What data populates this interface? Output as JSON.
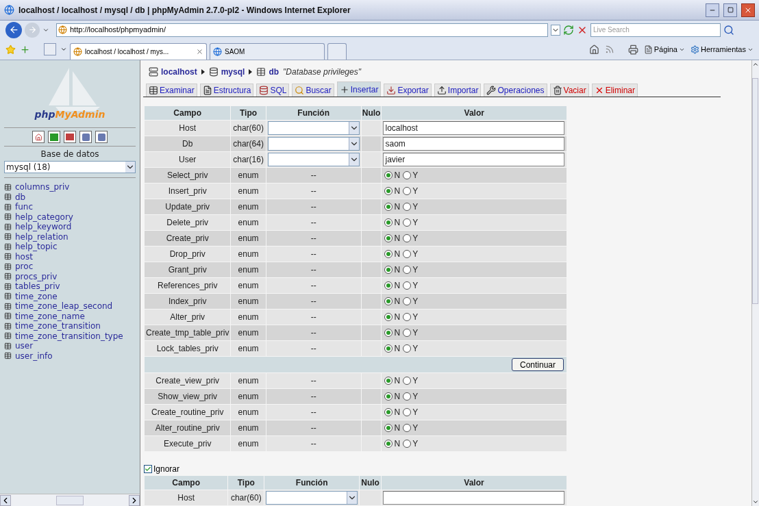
{
  "window": {
    "title": "localhost / localhost / mysql / db | phpMyAdmin 2.7.0-pl2 - Windows Internet Explorer",
    "address": "http://localhost/phpmyadmin/",
    "search_placeholder": "Live Search",
    "tabs": [
      {
        "label": "localhost / localhost / mys...",
        "selected": true
      },
      {
        "label": "SAOM",
        "selected": false
      }
    ],
    "tools": [
      "Página",
      "Herramientas"
    ]
  },
  "sidebar": {
    "logo": [
      "php",
      "MyAdmin"
    ],
    "database_label": "Base de datos",
    "database": "mysql (18)",
    "tables": [
      "columns_priv",
      "db",
      "func",
      "help_category",
      "help_keyword",
      "help_relation",
      "help_topic",
      "host",
      "proc",
      "procs_priv",
      "tables_priv",
      "time_zone",
      "time_zone_leap_second",
      "time_zone_name",
      "time_zone_transition",
      "time_zone_transition_type",
      "user",
      "user_info"
    ]
  },
  "breadcrumb": [
    {
      "label": "localhost",
      "kind": "server"
    },
    {
      "label": "mysql",
      "kind": "database"
    },
    {
      "label": "db",
      "kind": "table"
    }
  ],
  "table_comment": "\"Database privileges\"",
  "tabs": [
    {
      "label": "Examinar",
      "kind": "browse",
      "selected": false,
      "danger": false
    },
    {
      "label": "Estructura",
      "kind": "structure",
      "selected": false,
      "danger": false
    },
    {
      "label": "SQL",
      "kind": "sql",
      "selected": false,
      "danger": false
    },
    {
      "label": "Buscar",
      "kind": "search",
      "selected": false,
      "danger": false
    },
    {
      "label": "Insertar",
      "kind": "insert",
      "selected": true,
      "danger": false
    },
    {
      "label": "Exportar",
      "kind": "export",
      "selected": false,
      "danger": false
    },
    {
      "label": "Importar",
      "kind": "import",
      "selected": false,
      "danger": false
    },
    {
      "label": "Operaciones",
      "kind": "operations",
      "selected": false,
      "danger": false
    },
    {
      "label": "Vaciar",
      "kind": "empty",
      "selected": false,
      "danger": true
    },
    {
      "label": "Eliminar",
      "kind": "drop",
      "selected": false,
      "danger": true
    }
  ],
  "sections": [
    {
      "columns": [
        "Campo",
        "Tipo",
        "Función",
        "Nulo",
        "Valor"
      ],
      "rows": [
        {
          "kind": "text",
          "field": "Host",
          "type": "char(60)",
          "value": "localhost"
        },
        {
          "kind": "text",
          "field": "Db",
          "type": "char(64)",
          "value": "saom"
        },
        {
          "kind": "text",
          "field": "User",
          "type": "char(16)",
          "value": "javier"
        },
        {
          "kind": "enum",
          "field": "Select_priv",
          "type": "enum",
          "function": "--",
          "options": [
            {
              "label": "N",
              "selected": true
            },
            {
              "label": "Y",
              "selected": false
            }
          ]
        },
        {
          "kind": "enum",
          "field": "Insert_priv",
          "type": "enum",
          "function": "--",
          "options": [
            {
              "label": "N",
              "selected": true
            },
            {
              "label": "Y",
              "selected": false
            }
          ]
        },
        {
          "kind": "enum",
          "field": "Update_priv",
          "type": "enum",
          "function": "--",
          "options": [
            {
              "label": "N",
              "selected": true
            },
            {
              "label": "Y",
              "selected": false
            }
          ]
        },
        {
          "kind": "enum",
          "field": "Delete_priv",
          "type": "enum",
          "function": "--",
          "options": [
            {
              "label": "N",
              "selected": true
            },
            {
              "label": "Y",
              "selected": false
            }
          ]
        },
        {
          "kind": "enum",
          "field": "Create_priv",
          "type": "enum",
          "function": "--",
          "options": [
            {
              "label": "N",
              "selected": true
            },
            {
              "label": "Y",
              "selected": false
            }
          ]
        },
        {
          "kind": "enum",
          "field": "Drop_priv",
          "type": "enum",
          "function": "--",
          "options": [
            {
              "label": "N",
              "selected": true
            },
            {
              "label": "Y",
              "selected": false
            }
          ]
        },
        {
          "kind": "enum",
          "field": "Grant_priv",
          "type": "enum",
          "function": "--",
          "options": [
            {
              "label": "N",
              "selected": true
            },
            {
              "label": "Y",
              "selected": false
            }
          ]
        },
        {
          "kind": "enum",
          "field": "References_priv",
          "type": "enum",
          "function": "--",
          "options": [
            {
              "label": "N",
              "selected": true
            },
            {
              "label": "Y",
              "selected": false
            }
          ]
        },
        {
          "kind": "enum",
          "field": "Index_priv",
          "type": "enum",
          "function": "--",
          "options": [
            {
              "label": "N",
              "selected": true
            },
            {
              "label": "Y",
              "selected": false
            }
          ]
        },
        {
          "kind": "enum",
          "field": "Alter_priv",
          "type": "enum",
          "function": "--",
          "options": [
            {
              "label": "N",
              "selected": true
            },
            {
              "label": "Y",
              "selected": false
            }
          ]
        },
        {
          "kind": "enum",
          "field": "Create_tmp_table_priv",
          "type": "enum",
          "function": "--",
          "options": [
            {
              "label": "N",
              "selected": true
            },
            {
              "label": "Y",
              "selected": false
            }
          ]
        },
        {
          "kind": "enum",
          "field": "Lock_tables_priv",
          "type": "enum",
          "function": "--",
          "options": [
            {
              "label": "N",
              "selected": true
            },
            {
              "label": "Y",
              "selected": false
            }
          ]
        },
        {
          "kind": "submit",
          "button": "Continuar"
        },
        {
          "kind": "enum",
          "field": "Create_view_priv",
          "type": "enum",
          "function": "--",
          "options": [
            {
              "label": "N",
              "selected": true
            },
            {
              "label": "Y",
              "selected": false
            }
          ]
        },
        {
          "kind": "enum",
          "field": "Show_view_priv",
          "type": "enum",
          "function": "--",
          "options": [
            {
              "label": "N",
              "selected": true
            },
            {
              "label": "Y",
              "selected": false
            }
          ]
        },
        {
          "kind": "enum",
          "field": "Create_routine_priv",
          "type": "enum",
          "function": "--",
          "options": [
            {
              "label": "N",
              "selected": true
            },
            {
              "label": "Y",
              "selected": false
            }
          ]
        },
        {
          "kind": "enum",
          "field": "Alter_routine_priv",
          "type": "enum",
          "function": "--",
          "options": [
            {
              "label": "N",
              "selected": true
            },
            {
              "label": "Y",
              "selected": false
            }
          ]
        },
        {
          "kind": "enum",
          "field": "Execute_priv",
          "type": "enum",
          "function": "--",
          "options": [
            {
              "label": "N",
              "selected": true
            },
            {
              "label": "Y",
              "selected": false
            }
          ]
        }
      ]
    },
    {
      "ignore": {
        "label": "Ignorar",
        "checked": true
      },
      "columns": [
        "Campo",
        "Tipo",
        "Función",
        "Nulo",
        "Valor"
      ],
      "rows": [
        {
          "kind": "text",
          "field": "Host",
          "type": "char(60)",
          "value": ""
        }
      ]
    }
  ]
}
